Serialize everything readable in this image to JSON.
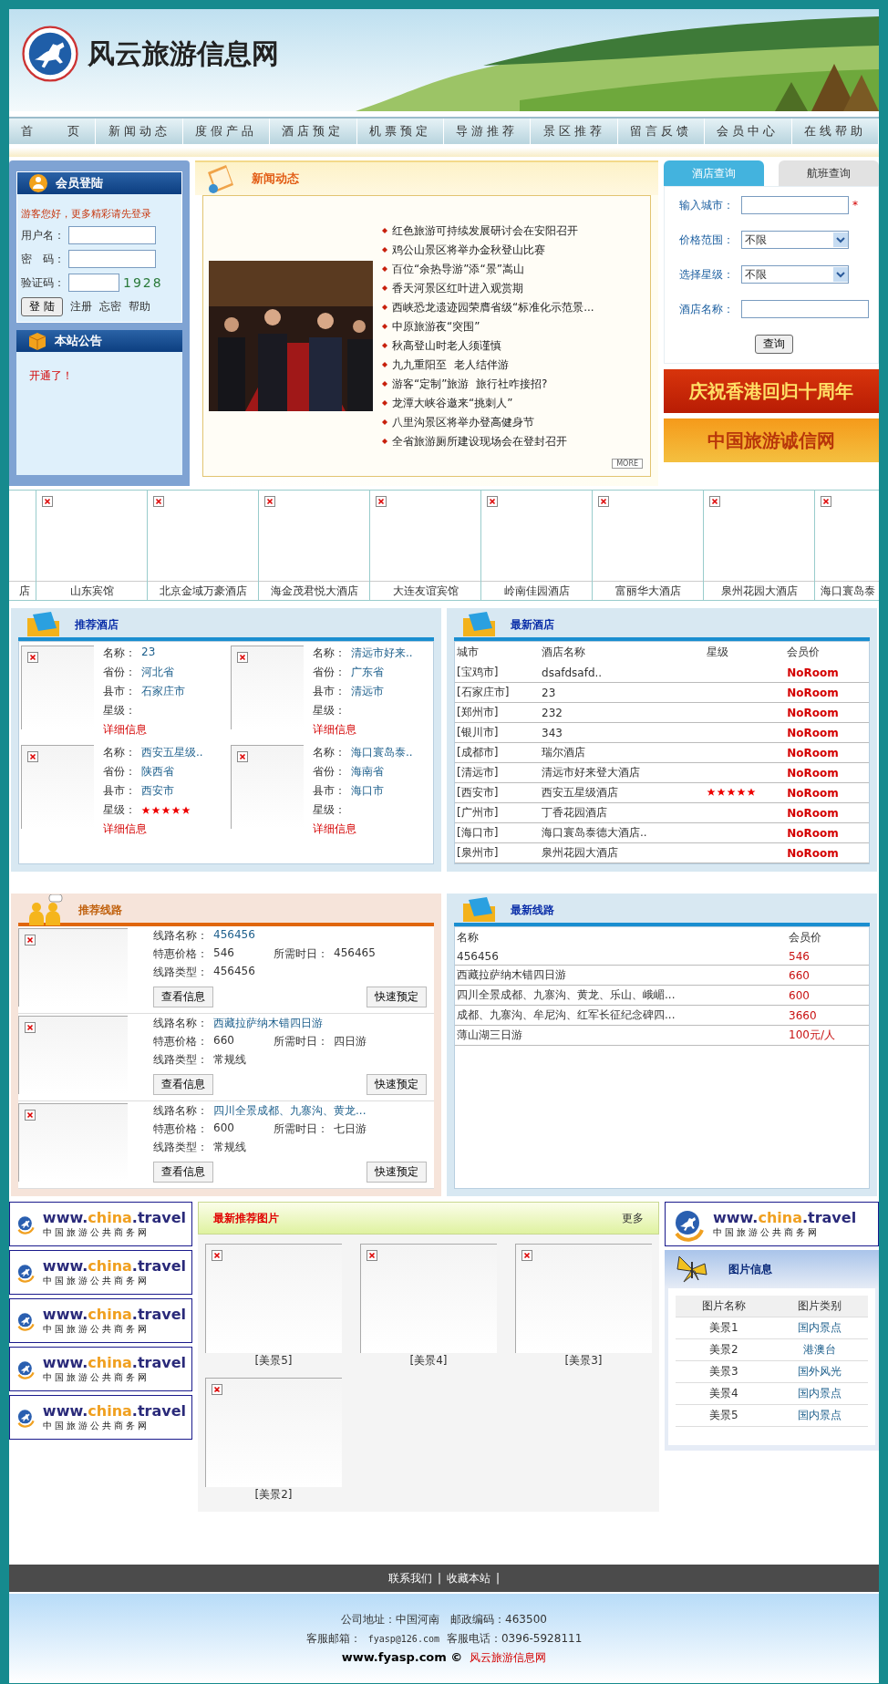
{
  "header": {
    "site_title": "风云旅游信息网"
  },
  "nav": [
    "首　　页",
    "新闻动态",
    "度假产品",
    "酒店预定",
    "机票预定",
    "导游推荐",
    "景区推荐",
    "留言反馈",
    "会员中心",
    "在线帮助"
  ],
  "login": {
    "title": "会员登陆",
    "greeting": "游客您好，更多精彩请先登录",
    "fields": [
      {
        "label": "用户名："
      },
      {
        "label": "密　码："
      },
      {
        "label": "验证码：",
        "captcha": "1928"
      }
    ],
    "button": "登 陆",
    "links": [
      "注册",
      "忘密",
      "帮助"
    ]
  },
  "notice": {
    "title": "本站公告",
    "text": "开通了！"
  },
  "news": {
    "title": "新闻动态",
    "more": "MORE",
    "items": [
      "红色旅游可持续发展研讨会在安阳召开",
      "鸡公山景区将举办金秋登山比赛",
      "百位“余热导游”添“景”嵩山",
      "香天河景区红叶进入观赏期",
      "西峡恐龙遗迹园荣膺省级“标准化示范景...",
      "中原旅游夜“突围”",
      "秋高登山时老人须谨慎",
      "九九重阳至  老人结伴游",
      "游客“定制”旅游  旅行社咋接招?",
      "龙潭大峡谷邀来“挑刺人”",
      "八里沟景区将举办登高健身节",
      "全省旅游厕所建设现场会在登封召开"
    ]
  },
  "search": {
    "tabs": [
      {
        "label": "酒店查询",
        "selected": true
      },
      {
        "label": "航班查询",
        "selected": false
      }
    ],
    "fields": [
      {
        "kind": "text",
        "label": "输入城市：",
        "required_mark": "*"
      },
      {
        "kind": "select",
        "label": "价格范围：",
        "value": "不限"
      },
      {
        "kind": "select",
        "label": "选择星级：",
        "value": "不限"
      },
      {
        "kind": "text",
        "label": "酒店名称："
      }
    ],
    "button": "查询"
  },
  "ads": [
    "庆祝香港回归十周年",
    "中国旅游诚信网"
  ],
  "hotel_strip": [
    "店",
    "山东宾馆",
    "北京金域万豪酒店",
    "海金茂君悦大酒店",
    "大连友谊宾馆",
    "岭南佳园酒店",
    "富丽华大酒店",
    "泉州花园大酒店",
    "海口寰岛泰"
  ],
  "recommended_hotels": {
    "title": "推荐酒店",
    "items": [
      {
        "fields": [
          {
            "label": "名称：",
            "value": "23"
          },
          {
            "label": "省份：",
            "value": "河北省"
          },
          {
            "label": "县市：",
            "value": "石家庄市"
          }
        ],
        "stars_label": "星级：",
        "detail": "详细信息"
      },
      {
        "fields": [
          {
            "label": "名称：",
            "value": "清远市好来.."
          },
          {
            "label": "省份：",
            "value": "广东省"
          },
          {
            "label": "县市：",
            "value": "清远市"
          }
        ],
        "stars_label": "星级：",
        "detail": "详细信息"
      },
      {
        "fields": [
          {
            "label": "名称：",
            "value": "西安五星级.."
          },
          {
            "label": "省份：",
            "value": "陕西省"
          },
          {
            "label": "县市：",
            "value": "西安市"
          }
        ],
        "stars_label": "星级：",
        "stars": 5,
        "detail": "详细信息"
      },
      {
        "fields": [
          {
            "label": "名称：",
            "value": "海口寰岛泰.."
          },
          {
            "label": "省份：",
            "value": "海南省"
          },
          {
            "label": "县市：",
            "value": "海口市"
          }
        ],
        "stars_label": "星级：",
        "detail": "详细信息"
      }
    ]
  },
  "latest_hotels": {
    "title": "最新酒店",
    "columns": [
      "城市",
      "酒店名称",
      "星级",
      "会员价"
    ],
    "rows": [
      {
        "city": "[宝鸡市]",
        "name": "dsafdsafd..",
        "price": "NoRoom"
      },
      {
        "city": "[石家庄市]",
        "name": "23",
        "price": "NoRoom"
      },
      {
        "city": "[郑州市]",
        "name": "232",
        "price": "NoRoom"
      },
      {
        "city": "[银川市]",
        "name": "343",
        "price": "NoRoom"
      },
      {
        "city": "[成都市]",
        "name": "瑞尔酒店",
        "price": "NoRoom"
      },
      {
        "city": "[清远市]",
        "name": "清远市好来登大酒店",
        "price": "NoRoom"
      },
      {
        "city": "[西安市]",
        "name": "西安五星级酒店",
        "stars": 5,
        "price": "NoRoom"
      },
      {
        "city": "[广州市]",
        "name": "丁香花园酒店",
        "price": "NoRoom"
      },
      {
        "city": "[海口市]",
        "name": "海口寰岛泰德大酒店..",
        "price": "NoRoom"
      },
      {
        "city": "[泉州市]",
        "name": "泉州花园大酒店",
        "price": "NoRoom"
      }
    ]
  },
  "recommended_routes": {
    "title": "推荐线路",
    "items": [
      {
        "name_label": "线路名称：",
        "name": "456456",
        "price_label": "特惠价格：",
        "price": "546",
        "days_label": "所需时日：",
        "days": "456465",
        "type_label": "线路类型：",
        "type": "456456",
        "buttons": [
          "查看信息",
          "快速预定"
        ]
      },
      {
        "name_label": "线路名称：",
        "name": "西藏拉萨纳木错四日游",
        "price_label": "特惠价格：",
        "price": "660",
        "days_label": "所需时日：",
        "days": "四日游",
        "type_label": "线路类型：",
        "type": "常规线",
        "buttons": [
          "查看信息",
          "快速预定"
        ]
      },
      {
        "name_label": "线路名称：",
        "name": "四川全景成都、九寨沟、黄龙...",
        "price_label": "特惠价格：",
        "price": "600",
        "days_label": "所需时日：",
        "days": "七日游",
        "type_label": "线路类型：",
        "type": "常规线",
        "buttons": [
          "查看信息",
          "快速预定"
        ]
      }
    ]
  },
  "latest_routes": {
    "title": "最新线路",
    "columns": [
      "名称",
      "会员价"
    ],
    "rows": [
      {
        "name": "456456",
        "price": "546"
      },
      {
        "name": "西藏拉萨纳木错四日游",
        "price": "660"
      },
      {
        "name": "四川全景成都、九寨沟、黄龙、乐山、峨嵋...",
        "price": "600"
      },
      {
        "name": "成都、九寨沟、牟尼沟、红军长征纪念碑四...",
        "price": "3660"
      },
      {
        "name": "薄山湖三日游",
        "price": "100元/人"
      }
    ]
  },
  "left_ads": [
    {
      "url": [
        "www.",
        "china",
        ".travel"
      ],
      "subtitle": "中国旅游公共商务网"
    },
    {
      "url": [
        "www.",
        "china",
        ".travel"
      ],
      "subtitle": "中国旅游公共商务网"
    },
    {
      "url": [
        "www.",
        "china",
        ".travel"
      ],
      "subtitle": "中国旅游公共商务网"
    },
    {
      "url": [
        "www.",
        "china",
        ".travel"
      ],
      "subtitle": "中国旅游公共商务网"
    },
    {
      "url": [
        "www.",
        "china",
        ".travel"
      ],
      "subtitle": "中国旅游公共商务网"
    }
  ],
  "pictures": {
    "title": "最新推荐图片",
    "more": "更多",
    "items": [
      "[美景5]",
      "[美景4]",
      "[美景3]",
      "[美景2]"
    ]
  },
  "right_ad": {
    "url": [
      "www.",
      "china",
      ".travel"
    ],
    "subtitle": "中国旅游公共商务网"
  },
  "picture_info": {
    "title": "图片信息",
    "columns": [
      "图片名称",
      "图片类别"
    ],
    "rows": [
      {
        "name": "美景1",
        "category": "国内景点"
      },
      {
        "name": "美景2",
        "category": "港澳台"
      },
      {
        "name": "美景3",
        "category": "国外风光"
      },
      {
        "name": "美景4",
        "category": "国内景点"
      },
      {
        "name": "美景5",
        "category": "国内景点"
      }
    ]
  },
  "footer": {
    "links": [
      "联系我们",
      "收藏本站"
    ],
    "separator": "|",
    "address": "公司地址：中国河南　邮政编码：463500",
    "email_label": "客服邮箱：",
    "email": "fyasp@126.com",
    "phone": "客服电话：0396-5928111",
    "site": "www.fyasp.com ©",
    "site_name": "风云旅游信息网"
  }
}
